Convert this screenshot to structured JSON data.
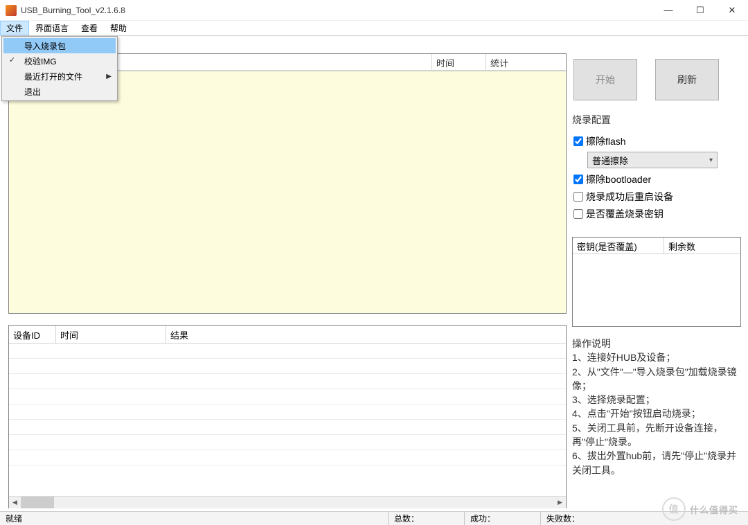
{
  "window": {
    "title": "USB_Burning_Tool_v2.1.6.8"
  },
  "menubar": {
    "file": "文件",
    "language": "界面语言",
    "view": "查看",
    "help": "帮助"
  },
  "file_menu": {
    "import": "导入烧录包",
    "verify": "校验IMG",
    "recent": "最近打开的文件",
    "exit": "退出"
  },
  "top_table": {
    "col_time": "时间",
    "col_stats": "统计"
  },
  "bottom_table": {
    "col_device": "设备ID",
    "col_time": "时间",
    "col_result": "结果"
  },
  "buttons": {
    "start": "开始",
    "refresh": "刷新"
  },
  "config": {
    "title": "烧录配置",
    "erase_flash": "擦除flash",
    "erase_mode": "普通擦除",
    "erase_bootloader": "擦除bootloader",
    "reboot_after": "烧录成功后重启设备",
    "overwrite_key": "是否覆盖烧录密钥"
  },
  "key_table": {
    "col_key": "密钥(是否覆盖)",
    "col_remain": "剩余数"
  },
  "instructions": {
    "title": "操作说明",
    "l1": "1、连接好HUB及设备；",
    "l2": "2、从\"文件\"—\"导入烧录包\"加载烧录镜像；",
    "l3": "3、选择烧录配置；",
    "l4": "4、点击\"开始\"按钮启动烧录；",
    "l5": "5、关闭工具前，先断开设备连接，再\"停止\"烧录。",
    "l6": "6、拔出外置hub前，请先\"停止\"烧录并关闭工具。"
  },
  "statusbar": {
    "ready": "就绪",
    "total": "总数：",
    "success": "成功：",
    "fail": "失败数："
  },
  "watermark": {
    "text": "什么值得买"
  }
}
